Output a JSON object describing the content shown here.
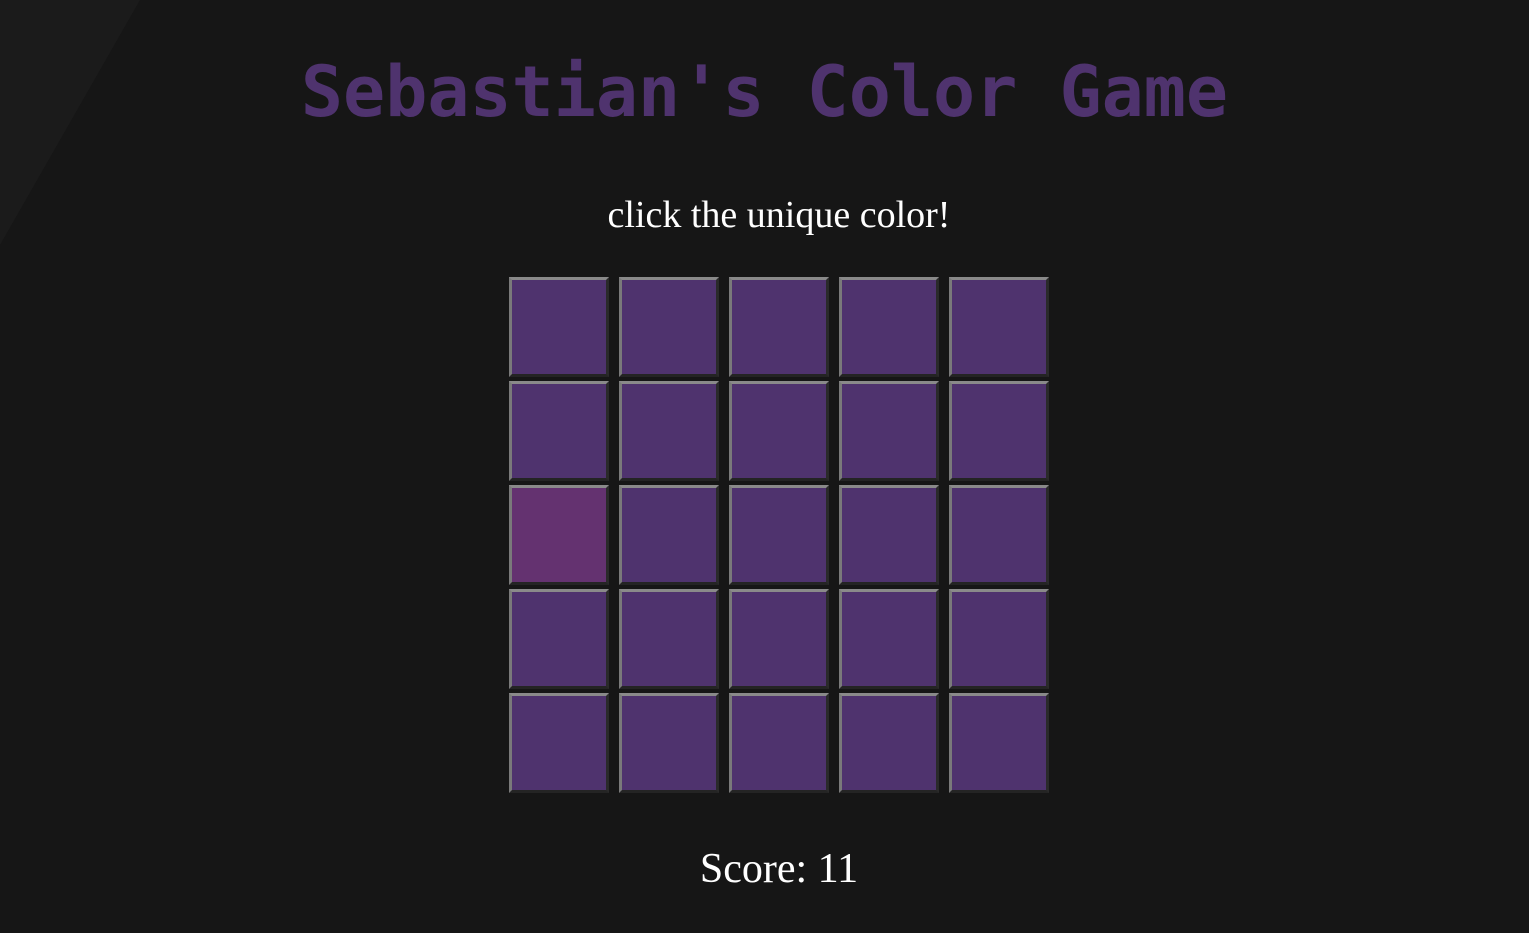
{
  "title": "Sebastian's Color Game",
  "instruction": "click the unique color!",
  "score_text": "Score: 11",
  "colors": {
    "title": "#4f336e",
    "tile": "#4f336e",
    "unique_tile": "#643270",
    "background": "#161616",
    "text": "#ffffff"
  },
  "grid": {
    "rows": 5,
    "cols": 5,
    "unique_tile": {
      "row": 3,
      "col": 1
    }
  }
}
